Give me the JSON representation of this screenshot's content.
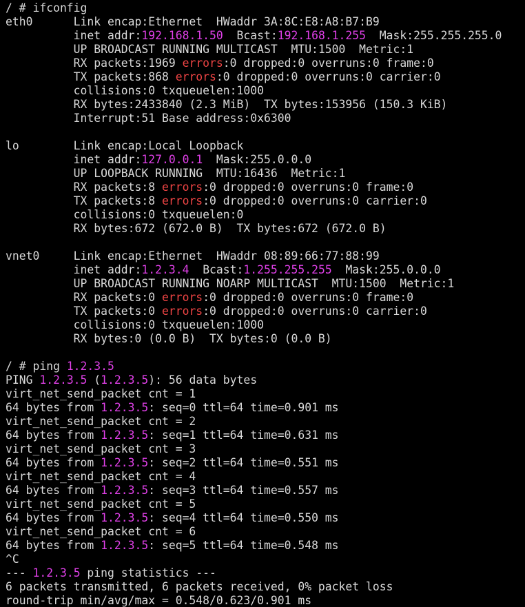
{
  "terminal": {
    "colors": {
      "background": "#000000",
      "foreground": "#d8d8d8",
      "ip_highlight": "#e040e8",
      "error_highlight": "#ee4444"
    },
    "lines": [
      [
        {
          "t": "/ # ifconfig"
        }
      ],
      [
        {
          "t": "eth0      Link encap:Ethernet  HWaddr 3A:8C:E8:A8:B7:B9"
        }
      ],
      [
        {
          "t": "          inet addr:"
        },
        {
          "t": "192.168.1.50",
          "c": "ip"
        },
        {
          "t": "  Bcast:"
        },
        {
          "t": "192.168.1.255",
          "c": "ip"
        },
        {
          "t": "  Mask:255.255.255.0"
        }
      ],
      [
        {
          "t": "          UP BROADCAST RUNNING MULTICAST  MTU:1500  Metric:1"
        }
      ],
      [
        {
          "t": "          RX packets:1969 "
        },
        {
          "t": "errors",
          "c": "err"
        },
        {
          "t": ":0 dropped:0 overruns:0 frame:0"
        }
      ],
      [
        {
          "t": "          TX packets:868 "
        },
        {
          "t": "errors",
          "c": "err"
        },
        {
          "t": ":0 dropped:0 overruns:0 carrier:0"
        }
      ],
      [
        {
          "t": "          collisions:0 txqueuelen:1000"
        }
      ],
      [
        {
          "t": "          RX bytes:2433840 (2.3 MiB)  TX bytes:153956 (150.3 KiB)"
        }
      ],
      [
        {
          "t": "          Interrupt:51 Base address:0x6300"
        }
      ],
      [
        {
          "t": ""
        }
      ],
      [
        {
          "t": "lo        Link encap:Local Loopback"
        }
      ],
      [
        {
          "t": "          inet addr:"
        },
        {
          "t": "127.0.0.1",
          "c": "ip"
        },
        {
          "t": "  Mask:255.0.0.0"
        }
      ],
      [
        {
          "t": "          UP LOOPBACK RUNNING  MTU:16436  Metric:1"
        }
      ],
      [
        {
          "t": "          RX packets:8 "
        },
        {
          "t": "errors",
          "c": "err"
        },
        {
          "t": ":0 dropped:0 overruns:0 frame:0"
        }
      ],
      [
        {
          "t": "          TX packets:8 "
        },
        {
          "t": "errors",
          "c": "err"
        },
        {
          "t": ":0 dropped:0 overruns:0 carrier:0"
        }
      ],
      [
        {
          "t": "          collisions:0 txqueuelen:0"
        }
      ],
      [
        {
          "t": "          RX bytes:672 (672.0 B)  TX bytes:672 (672.0 B)"
        }
      ],
      [
        {
          "t": ""
        }
      ],
      [
        {
          "t": "vnet0     Link encap:Ethernet  HWaddr 08:89:66:77:88:99"
        }
      ],
      [
        {
          "t": "          inet addr:"
        },
        {
          "t": "1.2.3.4",
          "c": "ip"
        },
        {
          "t": "  Bcast:"
        },
        {
          "t": "1.255.255.255",
          "c": "ip"
        },
        {
          "t": "  Mask:255.0.0.0"
        }
      ],
      [
        {
          "t": "          UP BROADCAST RUNNING NOARP MULTICAST  MTU:1500  Metric:1"
        }
      ],
      [
        {
          "t": "          RX packets:0 "
        },
        {
          "t": "errors",
          "c": "err"
        },
        {
          "t": ":0 dropped:0 overruns:0 frame:0"
        }
      ],
      [
        {
          "t": "          TX packets:0 "
        },
        {
          "t": "errors",
          "c": "err"
        },
        {
          "t": ":0 dropped:0 overruns:0 carrier:0"
        }
      ],
      [
        {
          "t": "          collisions:0 txqueuelen:1000"
        }
      ],
      [
        {
          "t": "          RX bytes:0 (0.0 B)  TX bytes:0 (0.0 B)"
        }
      ],
      [
        {
          "t": ""
        }
      ],
      [
        {
          "t": "/ # ping "
        },
        {
          "t": "1.2.3.5",
          "c": "ip"
        }
      ],
      [
        {
          "t": "PING "
        },
        {
          "t": "1.2.3.5",
          "c": "ip"
        },
        {
          "t": " ("
        },
        {
          "t": "1.2.3.5",
          "c": "ip"
        },
        {
          "t": "): 56 data bytes"
        }
      ],
      [
        {
          "t": "virt_net_send_packet cnt = 1"
        }
      ],
      [
        {
          "t": "64 bytes from "
        },
        {
          "t": "1.2.3.5",
          "c": "ip"
        },
        {
          "t": ": seq=0 ttl=64 time=0.901 ms"
        }
      ],
      [
        {
          "t": "virt_net_send_packet cnt = 2"
        }
      ],
      [
        {
          "t": "64 bytes from "
        },
        {
          "t": "1.2.3.5",
          "c": "ip"
        },
        {
          "t": ": seq=1 ttl=64 time=0.631 ms"
        }
      ],
      [
        {
          "t": "virt_net_send_packet cnt = 3"
        }
      ],
      [
        {
          "t": "64 bytes from "
        },
        {
          "t": "1.2.3.5",
          "c": "ip"
        },
        {
          "t": ": seq=2 ttl=64 time=0.551 ms"
        }
      ],
      [
        {
          "t": "virt_net_send_packet cnt = 4"
        }
      ],
      [
        {
          "t": "64 bytes from "
        },
        {
          "t": "1.2.3.5",
          "c": "ip"
        },
        {
          "t": ": seq=3 ttl=64 time=0.557 ms"
        }
      ],
      [
        {
          "t": "virt_net_send_packet cnt = 5"
        }
      ],
      [
        {
          "t": "64 bytes from "
        },
        {
          "t": "1.2.3.5",
          "c": "ip"
        },
        {
          "t": ": seq=4 ttl=64 time=0.550 ms"
        }
      ],
      [
        {
          "t": "virt_net_send_packet cnt = 6"
        }
      ],
      [
        {
          "t": "64 bytes from "
        },
        {
          "t": "1.2.3.5",
          "c": "ip"
        },
        {
          "t": ": seq=5 ttl=64 time=0.548 ms"
        }
      ],
      [
        {
          "t": "^C"
        }
      ],
      [
        {
          "t": "--- "
        },
        {
          "t": "1.2.3.5",
          "c": "ip"
        },
        {
          "t": " ping statistics ---"
        }
      ],
      [
        {
          "t": "6 packets transmitted, 6 packets received, 0% packet loss"
        }
      ],
      [
        {
          "t": "round-trip min/avg/max = 0.548/0.623/0.901 ms"
        }
      ]
    ]
  }
}
